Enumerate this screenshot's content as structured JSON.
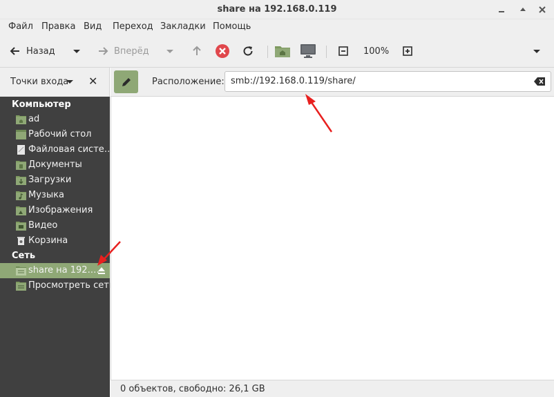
{
  "window": {
    "title": "share на 192.168.0.119"
  },
  "menu": {
    "items": [
      "Файл",
      "Правка",
      "Вид",
      "Переход",
      "Закладки",
      "Помощь"
    ]
  },
  "toolbar": {
    "back_label": "Назад",
    "forward_label": "Вперёд",
    "zoom_level": "100%"
  },
  "sidebar": {
    "header_label": "Точки входа",
    "section_computer": "Компьютер",
    "section_network": "Сеть",
    "computer_items": [
      {
        "label": "ad",
        "icon": "home-folder-icon"
      },
      {
        "label": "Рабочий стол",
        "icon": "desktop-icon"
      },
      {
        "label": "Файловая систе…",
        "icon": "filesystem-icon"
      },
      {
        "label": "Документы",
        "icon": "documents-folder-icon"
      },
      {
        "label": "Загрузки",
        "icon": "downloads-folder-icon"
      },
      {
        "label": "Музыка",
        "icon": "music-folder-icon"
      },
      {
        "label": "Изображения",
        "icon": "pictures-folder-icon"
      },
      {
        "label": "Видео",
        "icon": "videos-folder-icon"
      },
      {
        "label": "Корзина",
        "icon": "trash-icon"
      }
    ],
    "network_items": [
      {
        "label": "share на 192.…",
        "icon": "network-share-icon"
      },
      {
        "label": "Просмотреть сеть",
        "icon": "browse-network-icon"
      }
    ]
  },
  "location": {
    "label": "Расположение:",
    "value": "smb://192.168.0.119/share/"
  },
  "status": {
    "text": "0 объектов, свободно: 26,1 GB"
  },
  "colors": {
    "accent": "#8fa876",
    "sidebar_bg": "#404040",
    "stop_red": "#e0474c",
    "annotation_arrow": "#e8201f"
  }
}
